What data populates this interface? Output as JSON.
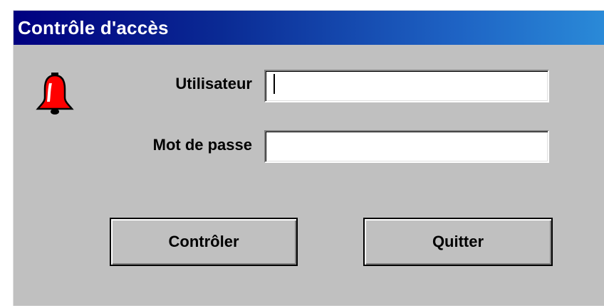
{
  "window": {
    "title": "Contrôle d'accès"
  },
  "form": {
    "user_label": "Utilisateur",
    "user_value": "",
    "password_label": "Mot de passe",
    "password_value": ""
  },
  "buttons": {
    "check_label": "Contrôler",
    "quit_label": "Quitter"
  },
  "icons": {
    "warning": "bell-icon"
  },
  "colors": {
    "title_bar_start": "#000080",
    "title_bar_end": "#2a8ad8",
    "dialog_background": "#c0c0c0",
    "bell_red": "#ff0000"
  }
}
